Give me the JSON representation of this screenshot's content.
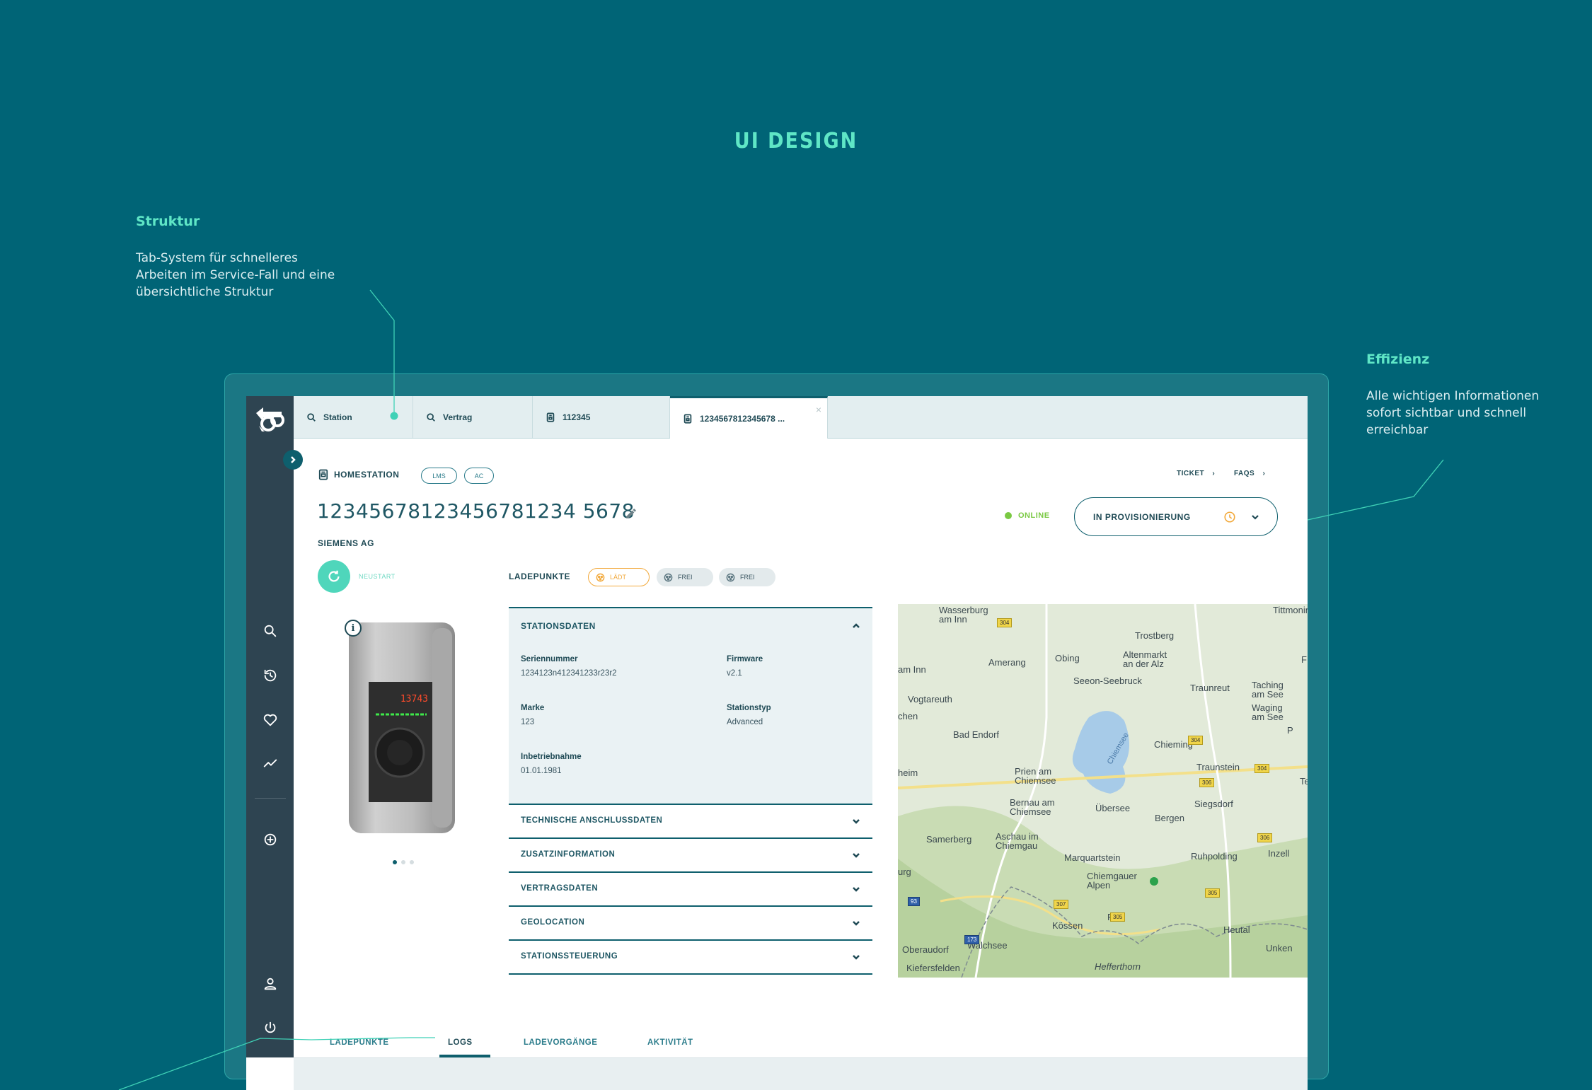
{
  "headline": "UI DESIGN",
  "annotations": {
    "struktur": {
      "title": "Struktur",
      "lines": [
        "Tab-System für schnelleres",
        "Arbeiten im Service-Fall und eine",
        "übersichtliche Struktur"
      ]
    },
    "effizienz": {
      "title": "Effizienz",
      "lines": [
        "Alle wichtigen Informationen",
        "sofort sichtbar und schnell",
        "erreichbar"
      ]
    }
  },
  "tabs": [
    {
      "label": "Station",
      "icon": "search-icon"
    },
    {
      "label": "Vertrag",
      "icon": "search-icon"
    },
    {
      "label": "112345",
      "icon": "station-icon"
    },
    {
      "label": "1234567812345678 ...",
      "icon": "station-icon",
      "close": "×"
    }
  ],
  "sidebar": {
    "icons": [
      "search-icon",
      "history-icon",
      "heart-icon",
      "trend-icon",
      "add-icon",
      "user-icon",
      "power-icon"
    ],
    "expand": "›"
  },
  "header": {
    "type_label": "HOMESTATION",
    "pills": [
      "LMS",
      "AC"
    ],
    "links": [
      "TICKET",
      "FAQS"
    ],
    "station_id": "12345678123456781234 5678",
    "company": "SIEMENS AG",
    "status": "ONLINE",
    "provisioning": "IN PROVISIONIERUNG",
    "status_color": "#7ac943"
  },
  "restart_label": "NEUSTART",
  "device_display": "13743",
  "ladepunkte": {
    "label": "LADEPUNKTE",
    "chips": [
      {
        "label": "LÄDT",
        "color": "#f2a93b"
      },
      {
        "label": "FREI",
        "color": "#5b7680"
      },
      {
        "label": "FREI",
        "color": "#5b7680"
      }
    ]
  },
  "stationsdaten": {
    "title": "STATIONSDATEN",
    "fields": [
      {
        "label": "Seriennummer",
        "value": "1234123n412341233r23r2"
      },
      {
        "label": "Firmware",
        "value": "v2.1"
      },
      {
        "label": "Marke",
        "value": "123"
      },
      {
        "label": "Stationstyp",
        "value": "Advanced"
      },
      {
        "label": "Inbetriebnahme",
        "value": "01.01.1981"
      }
    ]
  },
  "collapsed_sections": [
    "TECHNISCHE ANSCHLUSSDATEN",
    "ZUSATZINFORMATION",
    "VERTRAGSDATEN",
    "GEOLOCATION",
    "STATIONSSTEUERUNG"
  ],
  "map": {
    "places": [
      "Wasserburg am Inn",
      "Trostberg",
      "Tittmoning",
      "Obing",
      "Altenmarkt an der Alz",
      "Amerang",
      "am Inn",
      "Seeon-Seebruck",
      "Traunreut",
      "Taching am See",
      "Waging am See",
      "Vogtareuth",
      "chen",
      "Bad Endorf",
      "Chiemsee",
      "Chieming",
      "heim",
      "Prien am Chiemsee",
      "Traunstein",
      "Siegsdorf",
      "Bernau am Chiemsee",
      "Übersee",
      "Bergen",
      "Samerberg",
      "Aschau im Chiemgau",
      "Marquartstein",
      "Ruhpolding",
      "Inzell",
      "urg",
      "Chiemgauer Alpen",
      "Reit",
      "Heutal",
      "Oberaudorf",
      "Walchsee",
      "Kössen",
      "Unken",
      "Kiefersfelden",
      "Hefferthorn",
      "Tei",
      "P",
      "F"
    ],
    "roads": [
      "304",
      "304",
      "304",
      "306",
      "306",
      "305",
      "307",
      "305",
      "93",
      "173"
    ]
  },
  "bottom_tabs": [
    "LADEPUNKTE",
    "LOGS",
    "LADEVORGÄNGE",
    "AKTIVITÄT"
  ],
  "colors": {
    "background": "#006476",
    "accent": "#5fe6c6",
    "sidebar": "#2e4451",
    "primary": "#0e5f6d"
  }
}
